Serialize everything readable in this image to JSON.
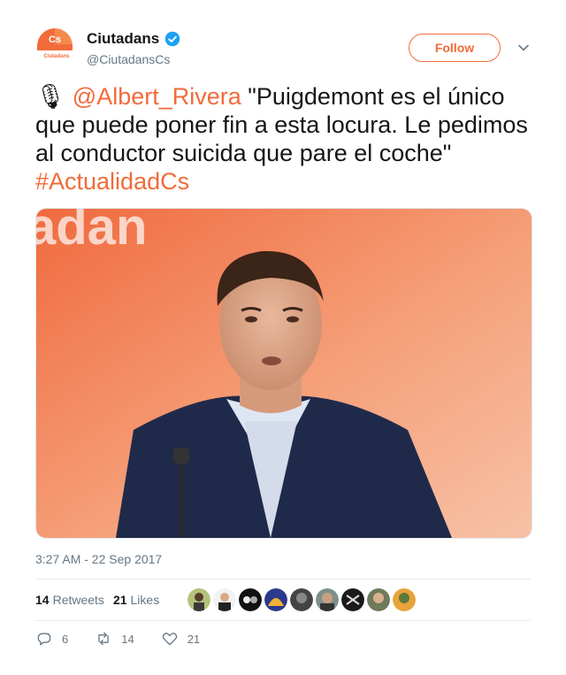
{
  "account": {
    "name": "Ciutadans",
    "handle": "@CiutadansCs",
    "logo_text": "Cs",
    "logo_subtext": "Ciutadans",
    "verified": true
  },
  "follow_label": "Follow",
  "tweet": {
    "emoji": "🎙",
    "mention": "@Albert_Rivera",
    "text": " \"Puigdemont es el único que puede poner fin a esta locura. Le pedimos al conductor suicida que pare el coche\" ",
    "hashtag": "#ActualidadCs"
  },
  "timestamp": "3:27 AM - 22 Sep 2017",
  "stats": {
    "retweets_count": "14",
    "retweets_label": "Retweets",
    "likes_count": "21",
    "likes_label": "Likes"
  },
  "actions": {
    "reply_count": "6",
    "retweet_count": "14",
    "like_count": "21"
  },
  "colors": {
    "brand_orange": "#f26b3a",
    "text": "#14171a",
    "muted": "#657786",
    "verified_blue": "#1da1f2"
  },
  "media": {
    "icon": "photo-speaker"
  }
}
